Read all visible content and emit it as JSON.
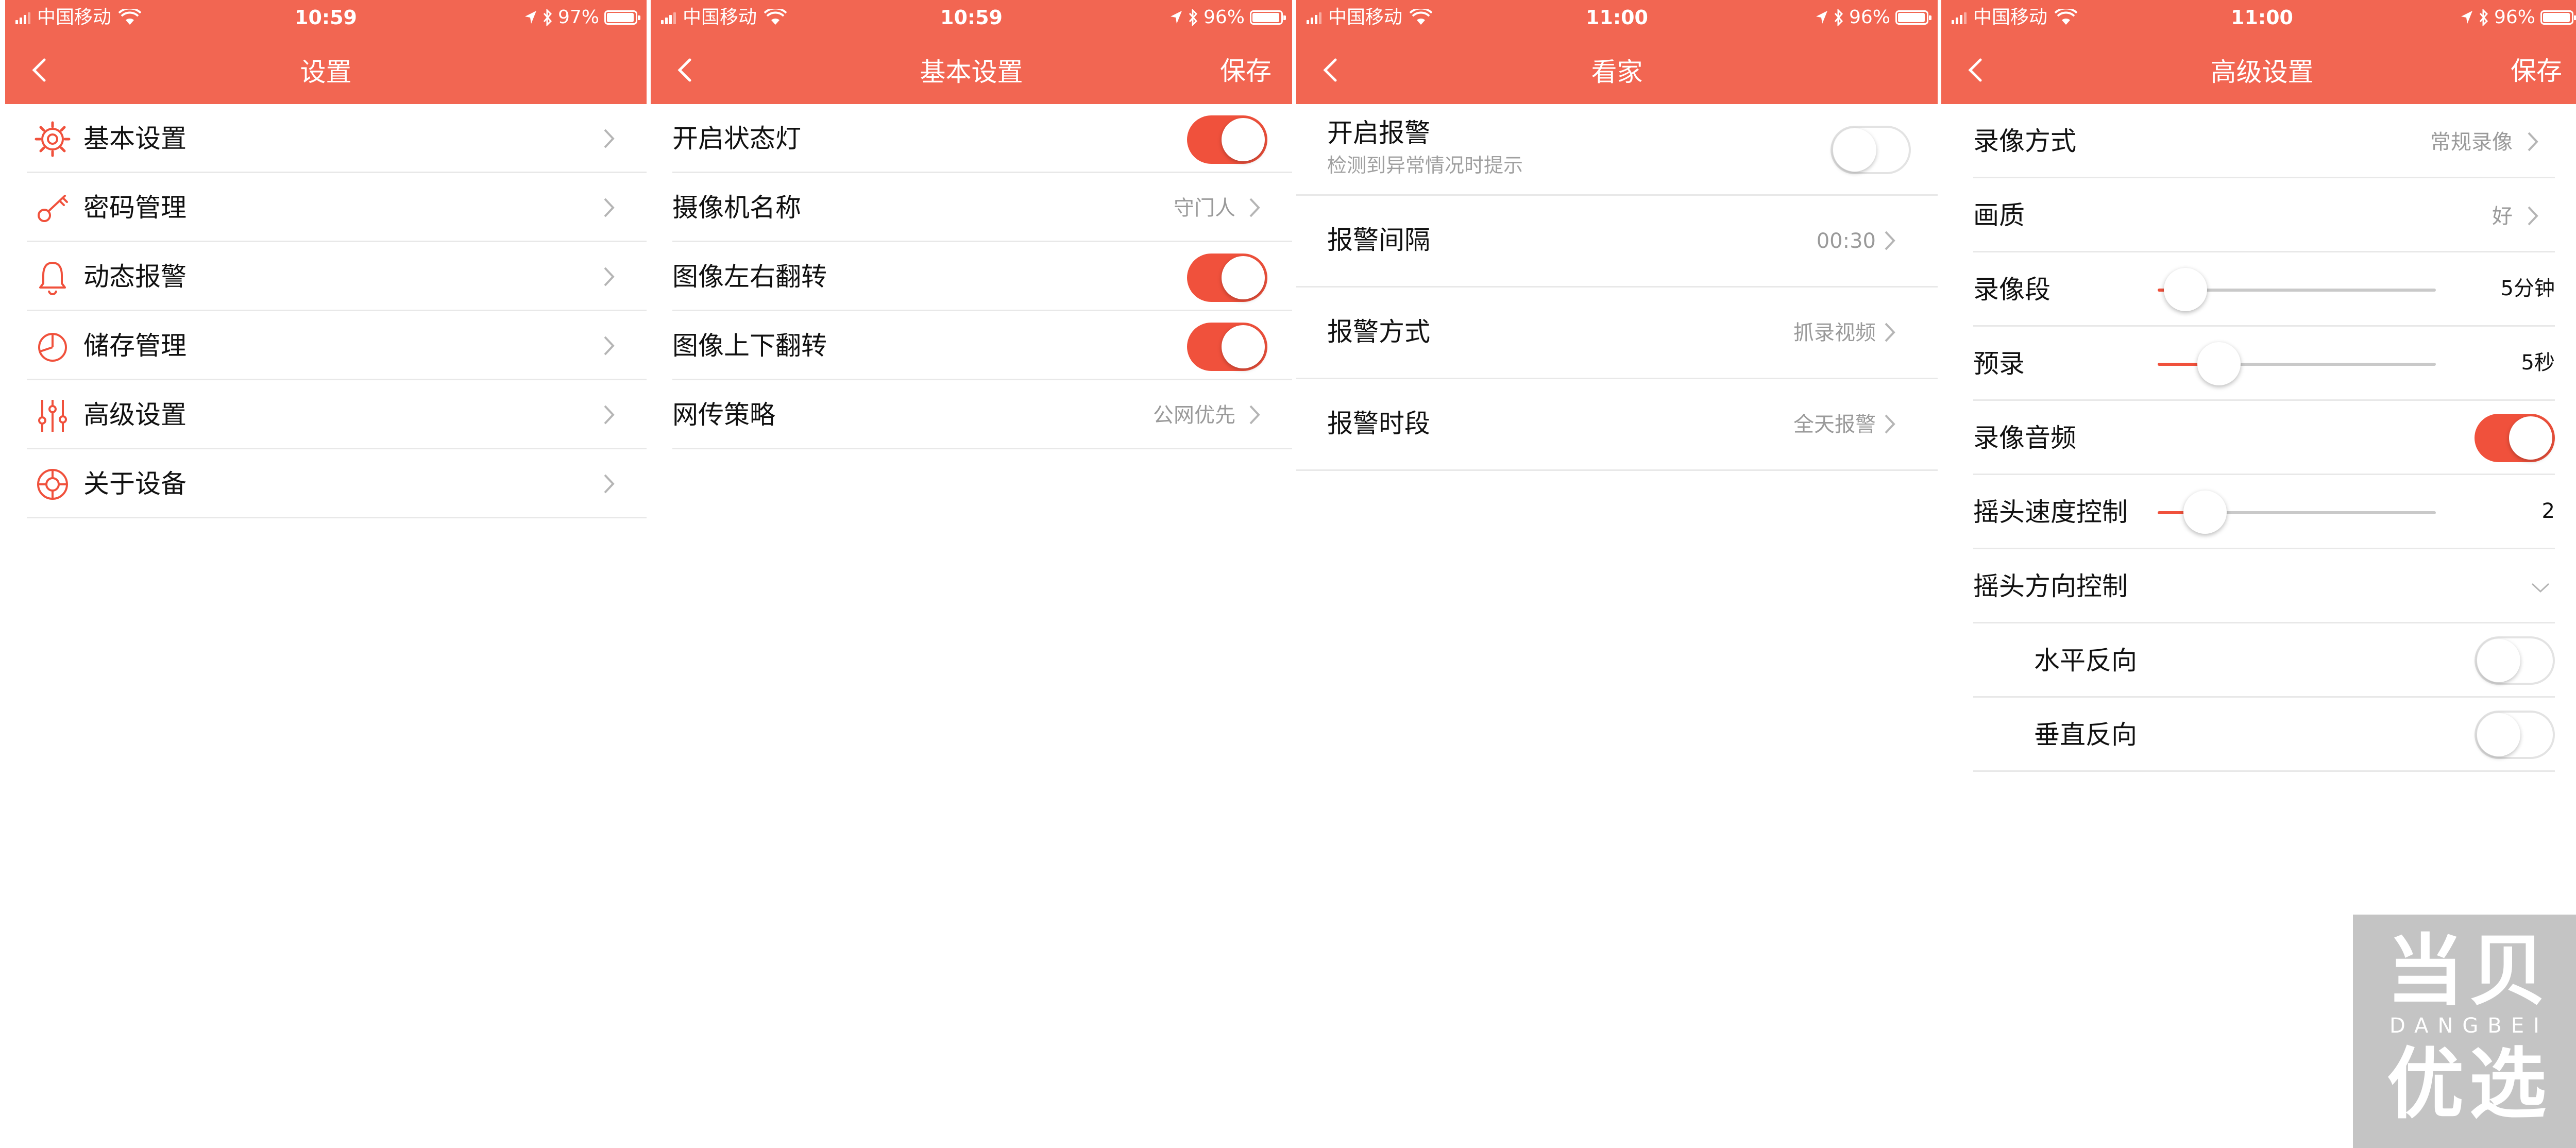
{
  "colors": {
    "accent": "#f26652",
    "toggle_on": "#f0513c",
    "separator": "#e8e8e8",
    "value_gray": "#9a9a9a"
  },
  "screens": [
    {
      "status": {
        "carrier": "中国移动",
        "time": "10:59",
        "battery": "97%",
        "battery_level": 0.97
      },
      "nav": {
        "title": "设置",
        "save": ""
      },
      "items": [
        {
          "label": "基本设置",
          "icon": "gear-icon"
        },
        {
          "label": "密码管理",
          "icon": "key-icon"
        },
        {
          "label": "动态报警",
          "icon": "bell-icon"
        },
        {
          "label": "储存管理",
          "icon": "pie-chart-icon"
        },
        {
          "label": "高级设置",
          "icon": "sliders-icon"
        },
        {
          "label": "关于设备",
          "icon": "lifebuoy-icon"
        }
      ]
    },
    {
      "status": {
        "carrier": "中国移动",
        "time": "10:59",
        "battery": "96%",
        "battery_level": 0.96
      },
      "nav": {
        "title": "基本设置",
        "save": "保存"
      },
      "items": [
        {
          "label": "开启状态灯",
          "toggle": true
        },
        {
          "label": "摄像机名称",
          "value": "守门人"
        },
        {
          "label": "图像左右翻转",
          "toggle": true
        },
        {
          "label": "图像上下翻转",
          "toggle": true
        },
        {
          "label": "网传策略",
          "value": "公网优先"
        }
      ]
    },
    {
      "status": {
        "carrier": "中国移动",
        "time": "11:00",
        "battery": "96%",
        "battery_level": 0.96
      },
      "nav": {
        "title": "看家",
        "save": ""
      },
      "items": [
        {
          "label": "开启报警",
          "subtitle": "检测到异常情况时提示",
          "toggle": false
        },
        {
          "label": "报警间隔",
          "value": "00:30"
        },
        {
          "label": "报警方式",
          "value": "抓录视频"
        },
        {
          "label": "报警时段",
          "value": "全天报警"
        }
      ]
    },
    {
      "status": {
        "carrier": "中国移动",
        "time": "11:00",
        "battery": "96%",
        "battery_level": 0.96
      },
      "nav": {
        "title": "高级设置",
        "save": "保存"
      },
      "items": [
        {
          "label": "录像方式",
          "value": "常规录像"
        },
        {
          "label": "画质",
          "value": "好"
        },
        {
          "label": "录像段",
          "slider_level": 0.1,
          "slider_value": "5分钟"
        },
        {
          "label": "预录",
          "slider_level": 0.22,
          "slider_value": "5秒"
        },
        {
          "label": "录像音频",
          "toggle": true
        },
        {
          "label": "摇头速度控制",
          "slider_level": 0.17,
          "slider_value": "2"
        },
        {
          "label": "摇头方向控制",
          "expanded": true
        },
        {
          "label": "水平反向",
          "toggle": false
        },
        {
          "label": "垂直反向",
          "toggle": false
        }
      ]
    }
  ],
  "watermark": {
    "line1": "当贝",
    "line2": "DANGBEI",
    "line3": "优选"
  }
}
